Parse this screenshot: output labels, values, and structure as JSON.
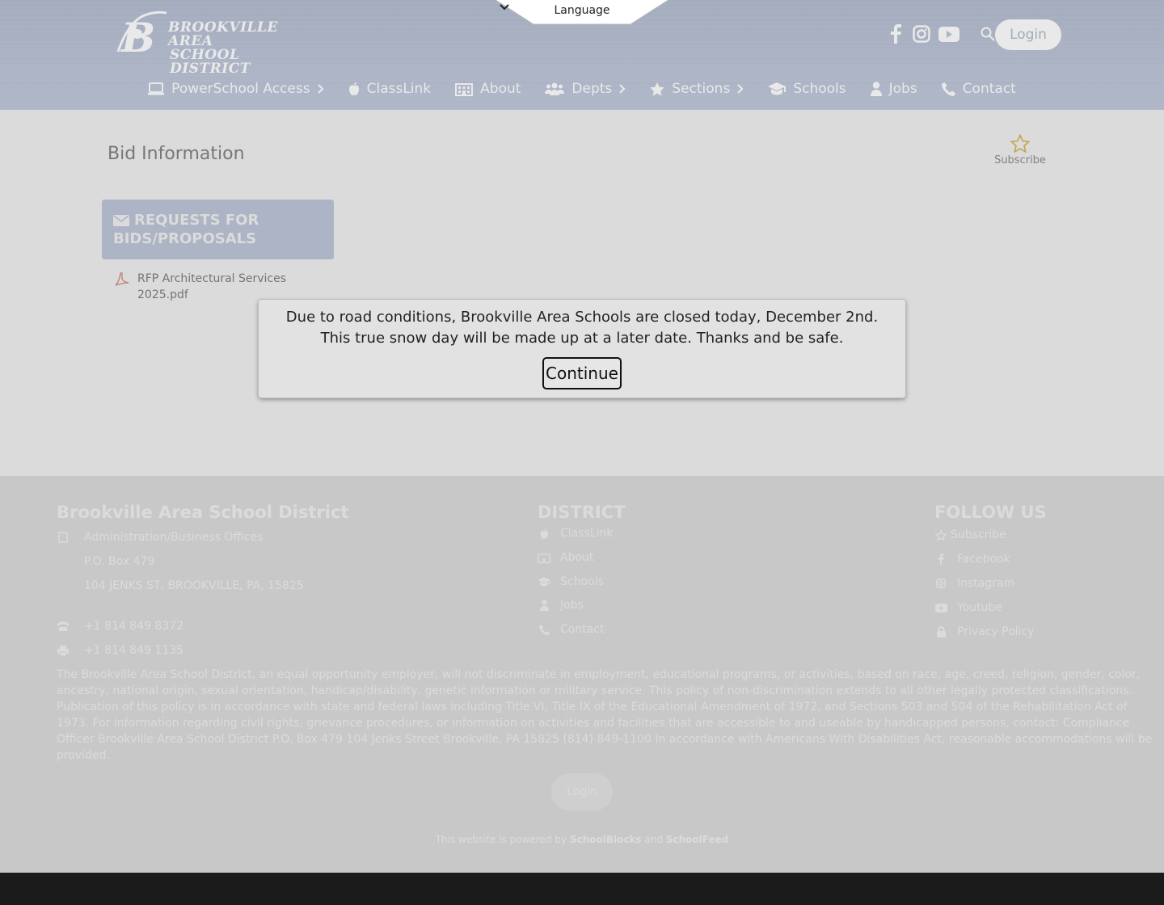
{
  "header": {
    "logo_line1": "BROOKVILLE AREA",
    "logo_line2": "SCHOOL DISTRICT",
    "language_label": "Language",
    "login_label": "Login",
    "social_icons": [
      "facebook-icon",
      "instagram-icon",
      "youtube-icon",
      "search-icon"
    ]
  },
  "nav": {
    "items": [
      {
        "label": "PowerSchool Access",
        "icon": "laptop-icon",
        "has_submenu": true
      },
      {
        "label": "ClassLink",
        "icon": "apple-icon",
        "has_submenu": false
      },
      {
        "label": "About",
        "icon": "building-icon",
        "has_submenu": false
      },
      {
        "label": "Depts",
        "icon": "users-icon",
        "has_submenu": true
      },
      {
        "label": "Sections",
        "icon": "star-icon",
        "has_submenu": true
      },
      {
        "label": "Schools",
        "icon": "graduation-cap-icon",
        "has_submenu": false
      },
      {
        "label": "Jobs",
        "icon": "user-icon",
        "has_submenu": false
      },
      {
        "label": "Contact",
        "icon": "phone-icon",
        "has_submenu": false
      }
    ]
  },
  "main": {
    "page_title": "Bid Information",
    "subscribe_label": "Subscribe",
    "card_title": "REQUESTS FOR BIDS/PROPOSALS",
    "file_link": "RFP Architectural Services 2025.pdf"
  },
  "modal": {
    "message": "Due to road conditions, Brookville Area Schools are closed today, December 2nd. This true snow day will be made up at a later date. Thanks and be safe.",
    "button_label": "Continue"
  },
  "footer": {
    "org_title": "Brookville Area School District",
    "address_line1": "Administration/Business Offices",
    "address_line2": "P.O. Box 479",
    "address_line3": "104 JENKS ST, BROOKVILLE, PA, 15825",
    "phone": "+1 814 849 8372",
    "fax": "+1 814 849 1135",
    "district_heading": "DISTRICT",
    "district_links": [
      "ClassLink",
      "About",
      "Schools",
      "Jobs",
      "Contact"
    ],
    "follow_heading": "FOLLOW US",
    "follow_links": [
      "Subscribe",
      "Facebook",
      "Instagram",
      "Youtube",
      "Privacy Policy"
    ],
    "disclaimer": "The Brookville Area School District, an equal opportunity employer, will not discriminate in employment, educational programs, or activities, based on race, age, creed, religion, gender, color, ancestry, national origin, sexual orientation, handicap/disability, genetic information or military service. This policy of non-discrimination extends to all other legally protected classifications. Publication of this policy is in accordance with state and federal laws including Title VI, Title IX of the Educational Amendment of 1972, and Sections 503 and 504 of the Rehabilitation Act of 1973. For information regarding civil rights, grievance procedures, or information on activities and facilities that are accessible to and useable by handicapped persons, contact: Compliance Officer Brookville Area School District P.O. Box 479 104 Jenks Street Brookville, PA 15825 (814) 849-1100 In accordance with Americans With Disabilities Act, reasonable accommodations will be provided.",
    "login_label": "Login",
    "powered_prefix": "This website is powered by",
    "powered_brand1": "SchoolBlocks",
    "powered_and": "and",
    "powered_brand2": "SchoolFeed"
  },
  "colors": {
    "header_blue": "#8d9cbd",
    "card_blue": "#c9d2e6",
    "footer_gray": "#e9e9e9",
    "modal_bg": "#e2e2e2"
  }
}
